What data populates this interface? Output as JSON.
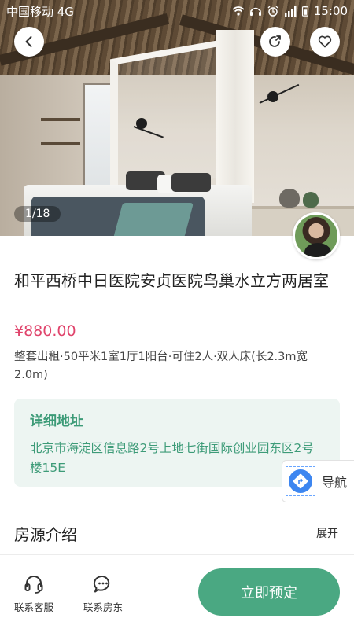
{
  "status_bar": {
    "carrier": "中国移动 4G",
    "time": "15:00",
    "icons": [
      "wifi-icon",
      "headphones-icon",
      "alarm-icon",
      "signal-icon",
      "battery-icon"
    ]
  },
  "gallery": {
    "counter": "1/18"
  },
  "listing": {
    "title": "和平西桥中日医院安贞医院鸟巢水立方两居室",
    "price": "¥880.00",
    "specs": "整套出租·50平米1室1厅1阳台·可住2人·双人床(长2.3m宽2.0m)"
  },
  "address": {
    "label": "详细地址",
    "text": "北京市海淀区信息路2号上地七街国际创业园东区2号楼15E"
  },
  "navigation": {
    "label": "导航"
  },
  "intro_section": {
    "title": "房源介绍",
    "expand_label": "展开"
  },
  "bottom_bar": {
    "service_label": "联系客服",
    "landlord_label": "联系房东",
    "book_label": "立即预定"
  },
  "colors": {
    "accent_green": "#4aa882",
    "address_text": "#3d9b78",
    "address_bg": "#edf5f2",
    "price": "#e0436b"
  }
}
